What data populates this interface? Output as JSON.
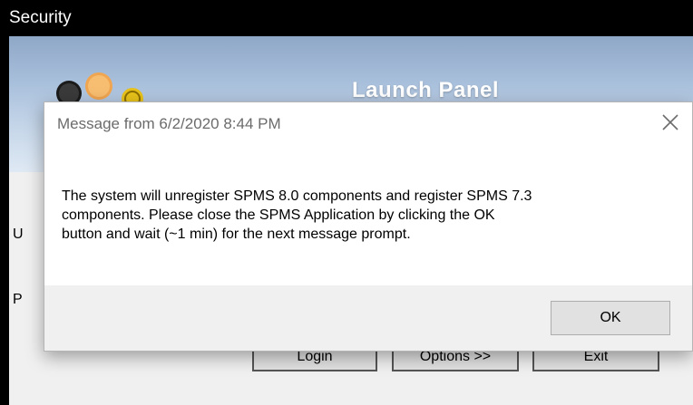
{
  "window": {
    "title": "Security"
  },
  "banner": {
    "title": "Launch Panel"
  },
  "form": {
    "label_1_partial": "U",
    "label_2_partial": "P"
  },
  "buttons": {
    "login": "Login",
    "options": "Options >>",
    "exit": "Exit"
  },
  "dialog": {
    "title": "Message from  6/2/2020 8:44 PM",
    "close_icon": "close-icon",
    "message_lines": [
      "The system will unregister SPMS 8.0 components and register SPMS 7.3",
      "components. Please close the SPMS Application by clicking the OK",
      "button and wait (~1 min) for the next message prompt."
    ],
    "ok_label": "OK"
  },
  "colors": {
    "titlebar": "#000000",
    "dialog_bg": "#ffffff",
    "footer_bg": "#f0f0f0",
    "button_bg": "#e1e1e1"
  }
}
